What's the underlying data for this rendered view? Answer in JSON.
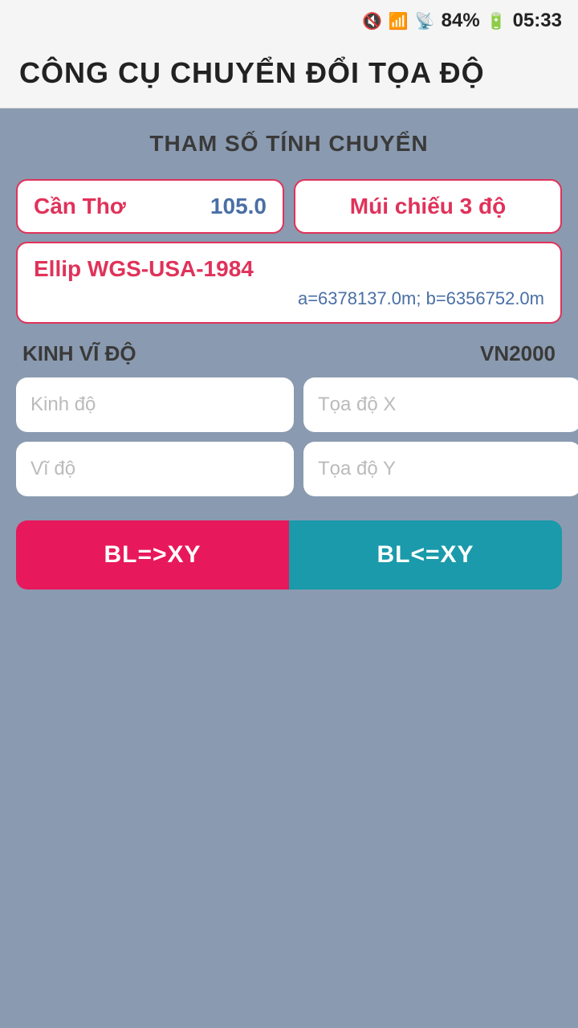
{
  "status_bar": {
    "battery": "84%",
    "time": "05:33"
  },
  "header": {
    "title": "CÔNG CỤ CHUYỂN ĐỔI TỌA ĐỘ"
  },
  "section": {
    "title": "THAM SỐ TÍNH CHUYỂN"
  },
  "selector1": {
    "region_label": "Cần Thơ",
    "value": "105.0"
  },
  "selector2": {
    "label": "Múi chiếu 3 độ"
  },
  "ellipsoid": {
    "name": "Ellip WGS-USA-1984",
    "params": "a=6378137.0m; b=6356752.0m"
  },
  "coord_section": {
    "left_label": "KINH VĨ ĐỘ",
    "right_label": "VN2000",
    "input_kinh_do": "Kinh độ",
    "input_vi_do": "Vĩ độ",
    "input_toa_do_x": "Tọa độ X",
    "input_toa_do_y": "Tọa độ Y"
  },
  "buttons": {
    "bl_to_xy": "BL=>XY",
    "xy_to_bl": "BL<=XY"
  }
}
